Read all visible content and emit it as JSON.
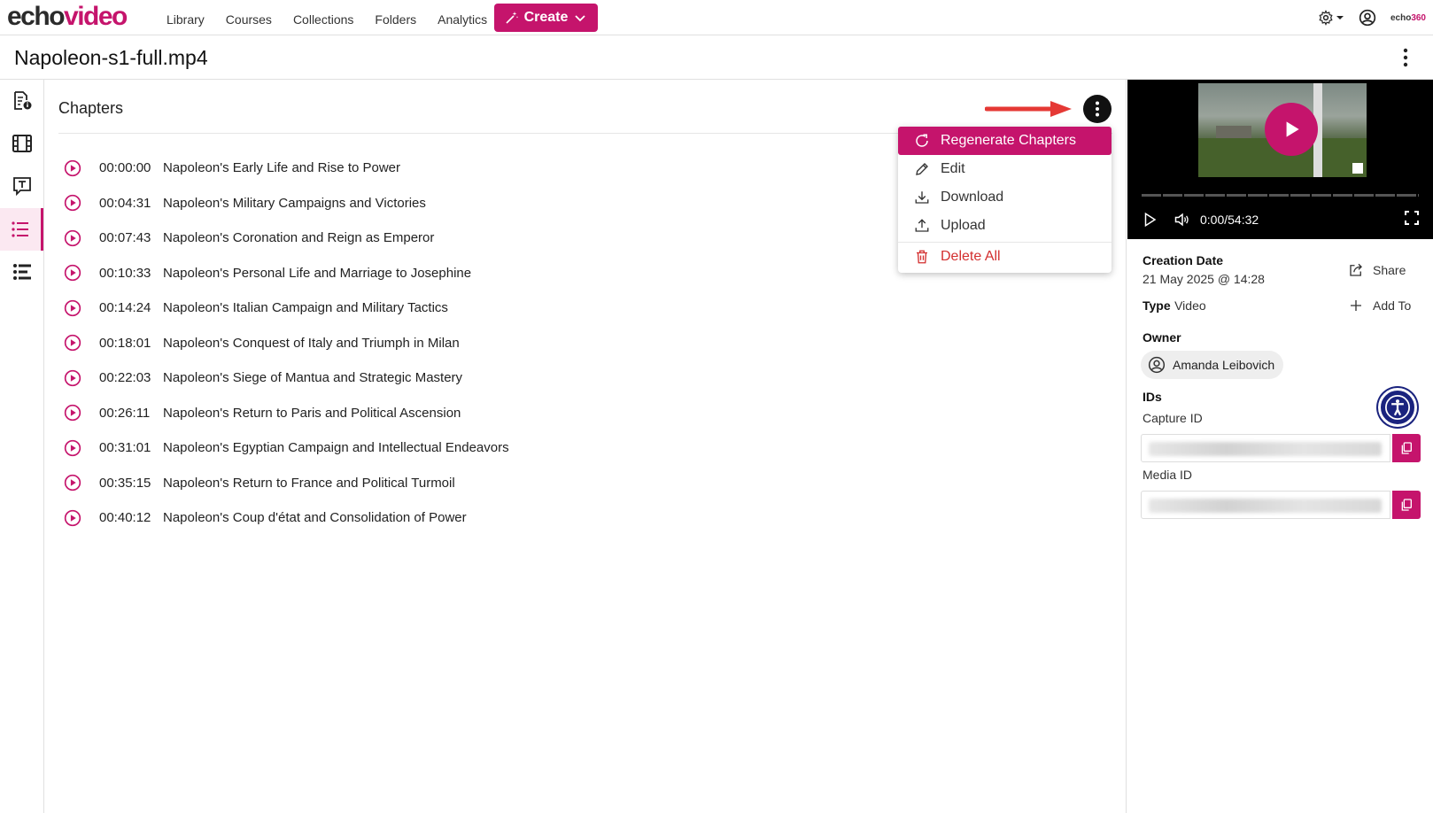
{
  "app": {
    "logo_echo": "echo",
    "logo_video": "video",
    "brand_small": "echo",
    "brand_small_accent": "360",
    "accent": "#c5146c"
  },
  "nav": {
    "items": [
      "Library",
      "Courses",
      "Collections",
      "Folders",
      "Analytics"
    ],
    "create_label": "Create"
  },
  "page": {
    "title": "Napoleon-s1-full.mp4"
  },
  "chapters": {
    "heading": "Chapters",
    "items": [
      {
        "time": "00:00:00",
        "label": "Napoleon's Early Life and Rise to Power"
      },
      {
        "time": "00:04:31",
        "label": "Napoleon's Military Campaigns and Victories"
      },
      {
        "time": "00:07:43",
        "label": "Napoleon's Coronation and Reign as Emperor"
      },
      {
        "time": "00:10:33",
        "label": "Napoleon's Personal Life and Marriage to Josephine"
      },
      {
        "time": "00:14:24",
        "label": "Napoleon's Italian Campaign and Military Tactics"
      },
      {
        "time": "00:18:01",
        "label": "Napoleon's Conquest of Italy and Triumph in Milan"
      },
      {
        "time": "00:22:03",
        "label": "Napoleon's Siege of Mantua and Strategic Mastery"
      },
      {
        "time": "00:26:11",
        "label": "Napoleon's Return to Paris and Political Ascension"
      },
      {
        "time": "00:31:01",
        "label": "Napoleon's Egyptian Campaign and Intellectual Endeavors"
      },
      {
        "time": "00:35:15",
        "label": "Napoleon's Return to France and Political Turmoil"
      },
      {
        "time": "00:40:12",
        "label": "Napoleon's Coup d'état and Consolidation of Power"
      }
    ]
  },
  "menu": {
    "regenerate": "Regenerate Chapters",
    "edit": "Edit",
    "download": "Download",
    "upload": "Upload",
    "delete_all": "Delete All"
  },
  "player": {
    "time": "0:00/54:32"
  },
  "details": {
    "creation_label": "Creation Date",
    "creation_value": "21 May 2025 @ 14:28",
    "type_label": "Type",
    "type_value": "Video",
    "owner_label": "Owner",
    "owner_name": "Amanda Leibovich",
    "ids_label": "IDs",
    "capture_label": "Capture ID",
    "media_label": "Media ID",
    "share_label": "Share",
    "addto_label": "Add To"
  }
}
